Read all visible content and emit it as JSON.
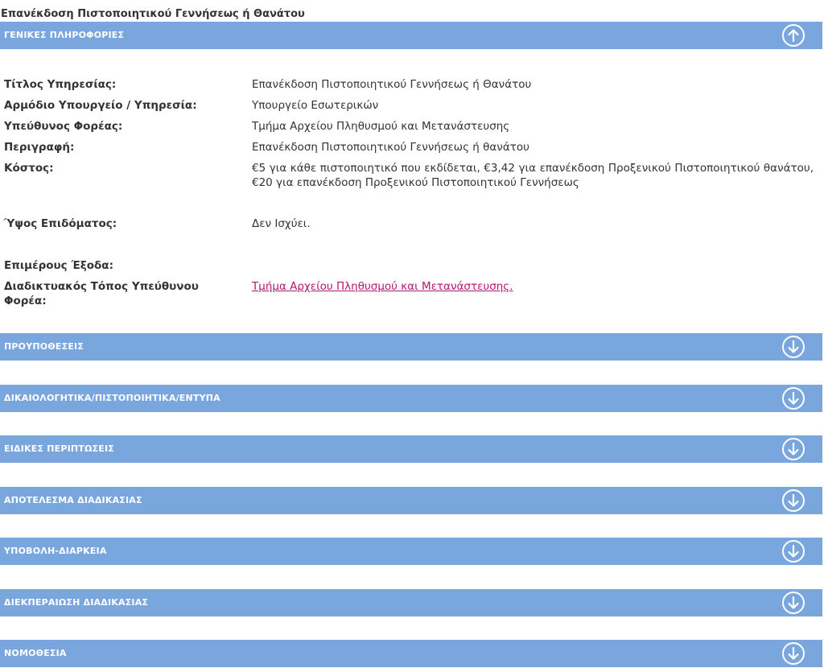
{
  "page": {
    "title": "Επανέκδοση Πιστοποιητικού Γεννήσεως ή Θανάτου"
  },
  "sections": [
    {
      "label": "ΓΕΝΙΚΕΣ ΠΛΗΡΟΦΟΡΙΕΣ",
      "icon": "arrow-up-circle-icon",
      "expanded": true
    },
    {
      "label": "ΠΡΟΥΠΟΘΕΣΕΙΣ",
      "icon": "arrow-down-circle-icon",
      "expanded": false
    },
    {
      "label": "ΔΙΚΑΙΟΛΟΓΗΤΙΚΑ/ΠΙΣΤΟΠΟΙΗΤΙΚΑ/ΕΝΤΥΠΑ",
      "icon": "arrow-down-circle-icon",
      "expanded": false
    },
    {
      "label": "ΕΙΔΙΚΕΣ ΠΕΡΙΠΤΩΣΕΙΣ",
      "icon": "arrow-down-circle-icon",
      "expanded": false
    },
    {
      "label": "ΑΠΟΤΕΛΕΣΜΑ ΔΙΑΔΙΚΑΣΙΑΣ",
      "icon": "arrow-down-circle-icon",
      "expanded": false
    },
    {
      "label": "ΥΠΟΒΟΛΗ-ΔΙΑΡΚΕΙΑ",
      "icon": "arrow-down-circle-icon",
      "expanded": false
    },
    {
      "label": "ΔΙΕΚΠΕΡΑΙΩΣΗ ΔΙΑΔΙΚΑΣΙΑΣ",
      "icon": "arrow-down-circle-icon",
      "expanded": false
    },
    {
      "label": "ΝΟΜΟΘΕΣΙΑ",
      "icon": "arrow-down-circle-icon",
      "expanded": false
    }
  ],
  "general_info": {
    "service_title": {
      "label": "Τίτλος Υπηρεσίας:",
      "value": "Επανέκδοση Πιστοποιητικού Γεννήσεως ή Θανάτου"
    },
    "ministry": {
      "label": "Αρμόδιο Υπουργείο / Υπηρεσία:",
      "value": "Υπουργείο Εσωτερικών"
    },
    "responsible_body": {
      "label": "Υπεύθυνος Φορέας:",
      "value": "Τμήμα Αρχείου Πληθυσμού και Μετανάστευσης"
    },
    "description": {
      "label": "Περιγραφή:",
      "value": "Επανέκδοση Πιστοποιητικού Γεννήσεως ή θανάτου"
    },
    "cost": {
      "label": "Κόστος:",
      "value": "€5 για κάθε πιστοποιητικό που εκδίδεται, €3,42 για επανέκδοση Προξενικού Πιστοποιητικού θανάτου, €20 για επανέκδοση Προξενικού Πιστοποιητικού Γεννήσεως"
    },
    "allowance": {
      "label": "Ύψος Επιδόματος:",
      "value": "Δεν Ισχύει."
    },
    "expenses": {
      "label": "Επιμέρους Έξοδα:",
      "value": ""
    },
    "website": {
      "label": "Διαδικτυακός Τόπος Υπεύθυνου Φορέα:",
      "value": "Τμήμα Αρχείου Πληθυσμού και Μετανάστευσης."
    }
  },
  "colors": {
    "bar": "#7aa6de",
    "link": "#b5166e",
    "text": "#333333"
  }
}
